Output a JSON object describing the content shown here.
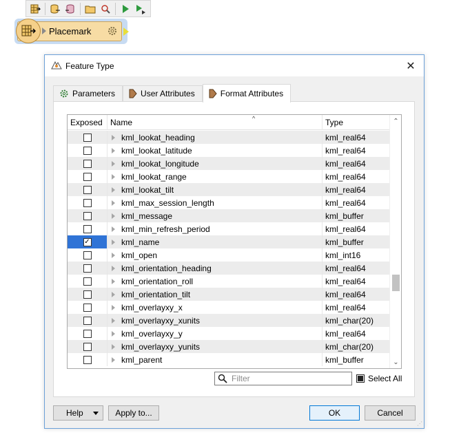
{
  "toolbar": {
    "icons": [
      "table-arrow-icon",
      "db-reader-icon",
      "db-writer-icon",
      "folder-icon",
      "inspect-icon",
      "run-icon",
      "run-to-icon"
    ]
  },
  "transformer": {
    "label": "Placemark"
  },
  "dialog": {
    "title": "Feature Type",
    "tabs": [
      {
        "label": "Parameters",
        "icon": "gear-icon"
      },
      {
        "label": "User Attributes",
        "icon": "attribute-arrow-icon"
      },
      {
        "label": "Format Attributes",
        "icon": "attribute-arrow-icon",
        "active": true
      }
    ],
    "table": {
      "headers": {
        "exposed": "Exposed",
        "name": "Name",
        "type": "Type"
      },
      "rows": [
        {
          "name": "kml_lookat_heading",
          "type": "kml_real64",
          "exposed": false
        },
        {
          "name": "kml_lookat_latitude",
          "type": "kml_real64",
          "exposed": false
        },
        {
          "name": "kml_lookat_longitude",
          "type": "kml_real64",
          "exposed": false
        },
        {
          "name": "kml_lookat_range",
          "type": "kml_real64",
          "exposed": false
        },
        {
          "name": "kml_lookat_tilt",
          "type": "kml_real64",
          "exposed": false
        },
        {
          "name": "kml_max_session_length",
          "type": "kml_real64",
          "exposed": false
        },
        {
          "name": "kml_message",
          "type": "kml_buffer",
          "exposed": false
        },
        {
          "name": "kml_min_refresh_period",
          "type": "kml_real64",
          "exposed": false
        },
        {
          "name": "kml_name",
          "type": "kml_buffer",
          "exposed": true
        },
        {
          "name": "kml_open",
          "type": "kml_int16",
          "exposed": false
        },
        {
          "name": "kml_orientation_heading",
          "type": "kml_real64",
          "exposed": false
        },
        {
          "name": "kml_orientation_roll",
          "type": "kml_real64",
          "exposed": false
        },
        {
          "name": "kml_orientation_tilt",
          "type": "kml_real64",
          "exposed": false
        },
        {
          "name": "kml_overlayxy_x",
          "type": "kml_real64",
          "exposed": false
        },
        {
          "name": "kml_overlayxy_xunits",
          "type": "kml_char(20)",
          "exposed": false
        },
        {
          "name": "kml_overlayxy_y",
          "type": "kml_real64",
          "exposed": false
        },
        {
          "name": "kml_overlayxy_yunits",
          "type": "kml_char(20)",
          "exposed": false
        },
        {
          "name": "kml_parent",
          "type": "kml_buffer",
          "exposed": false
        }
      ]
    },
    "filter": {
      "placeholder": "Filter",
      "value": ""
    },
    "select_all": {
      "label": "Select All",
      "checked": false
    },
    "buttons": {
      "help": "Help",
      "apply": "Apply to...",
      "ok": "OK",
      "cancel": "Cancel"
    }
  },
  "colors": {
    "selection": "#2f73d6",
    "transformer_fill": "#f7dca4",
    "dialog_border": "#6aa0d8"
  }
}
